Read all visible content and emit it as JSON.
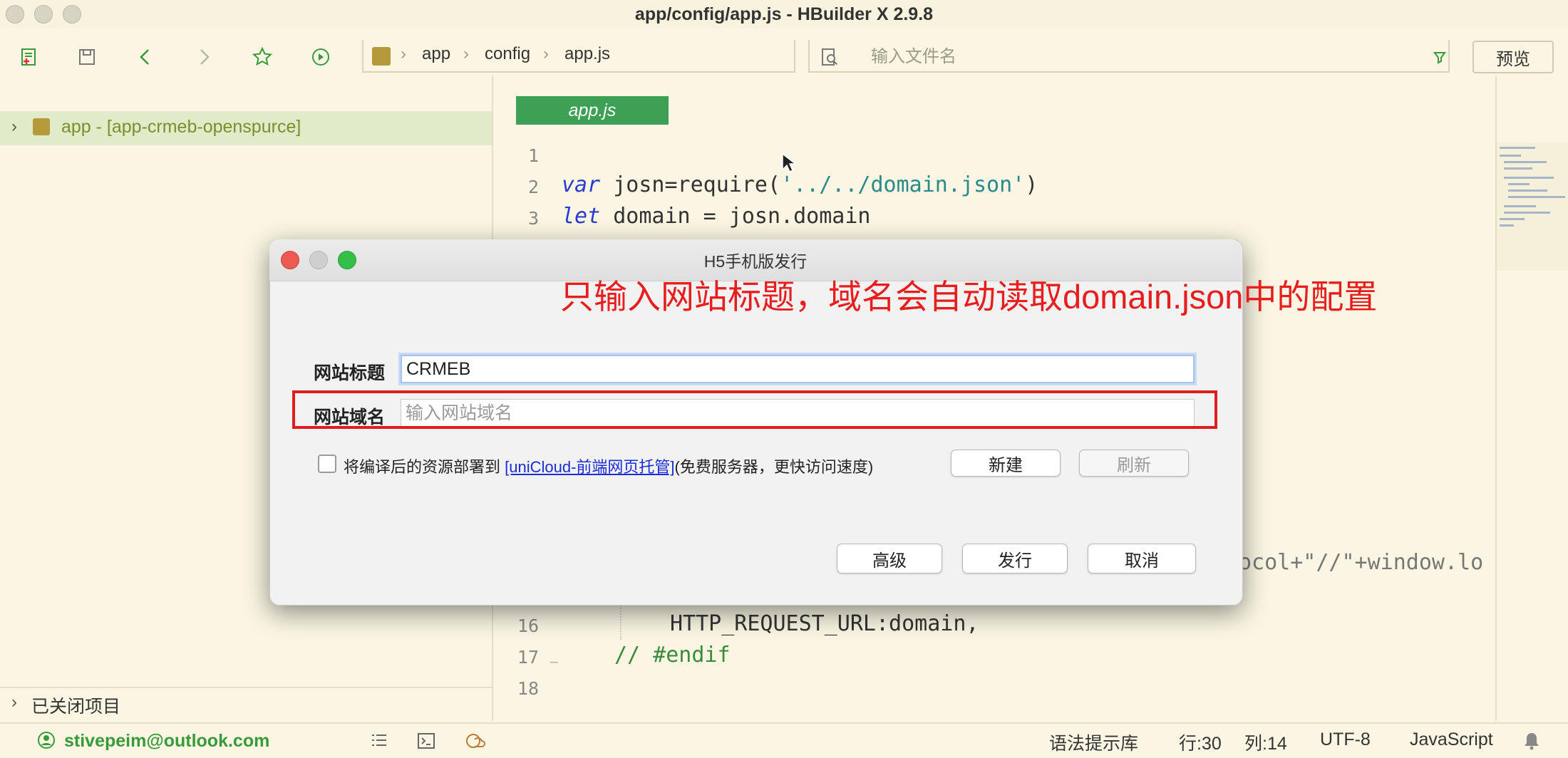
{
  "window": {
    "title": "app/config/app.js - HBuilder X 2.9.8"
  },
  "toolbar": {
    "breadcrumb": [
      "app",
      "config",
      "app.js"
    ],
    "file_search_placeholder": "输入文件名",
    "preview_label": "预览"
  },
  "sidebar": {
    "project_label": "app - [app-crmeb-openspurce]",
    "closed_projects_label": "已关闭项目"
  },
  "editor": {
    "tab_label": "app.js",
    "lines": [
      {
        "num": "1"
      },
      {
        "num": "2",
        "kw": "var",
        "text": " josn=require(",
        "str": "'../../domain.json'",
        "end": ")"
      },
      {
        "num": "3",
        "kw": "let",
        "text": " domain = josn.domain"
      },
      {
        "num": "16",
        "text": "HTTP_REQUEST_URL:domain,"
      },
      {
        "num": "17",
        "text": "// #endif"
      },
      {
        "num": "18"
      }
    ],
    "partial_line": "ocol+\"//\"+window.lo"
  },
  "dialog": {
    "title": "H5手机版发行",
    "annotation": "只输入网站标题，域名会自动读取domain.json中的配置",
    "site_title_label": "网站标题",
    "site_title_value": "CRMEB",
    "site_domain_label": "网站域名",
    "site_domain_placeholder": "输入网站域名",
    "deploy_prefix": "将编译后的资源部署到",
    "deploy_link": "[uniCloud-前端网页托管]",
    "deploy_suffix": "(免费服务器，更快访问速度)",
    "new_label": "新建",
    "refresh_label": "刷新",
    "advanced_label": "高级",
    "publish_label": "发行",
    "cancel_label": "取消"
  },
  "statusbar": {
    "user": "stivepeim@outlook.com",
    "syntax_lib": "语法提示库",
    "row": "行:30",
    "col": "列:14",
    "encoding": "UTF-8",
    "language": "JavaScript"
  },
  "colors": {
    "accent": "#3ea055",
    "annotation": "#e81e1e",
    "link": "#1a2bd8"
  }
}
